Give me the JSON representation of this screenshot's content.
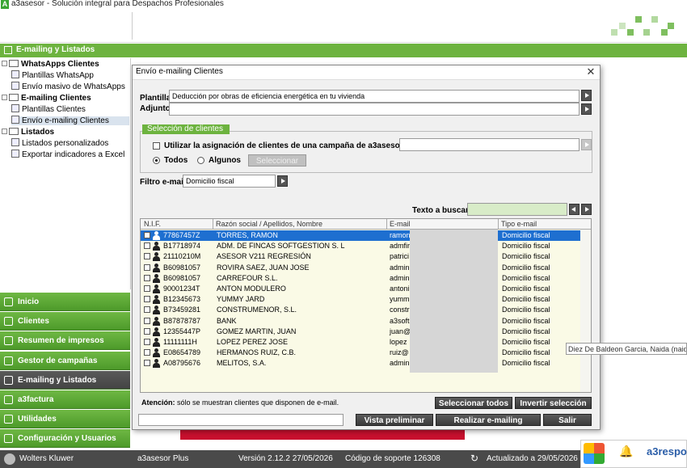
{
  "window": {
    "title": "a3asesor - Solución integral para Despachos Profesionales",
    "logo_letter": "A"
  },
  "section_bar": {
    "label": "E-mailing y Listados"
  },
  "tree": [
    {
      "label": "WhatsApps Clientes",
      "level": 0,
      "bold": true
    },
    {
      "label": "Plantillas WhatsApp",
      "level": 1
    },
    {
      "label": "Envío masivo de WhatsApps",
      "level": 1
    },
    {
      "label": "E-mailing Clientes",
      "level": 0,
      "bold": true
    },
    {
      "label": "Plantillas Clientes",
      "level": 1
    },
    {
      "label": "Envío e-mailing Clientes",
      "level": 1,
      "selected": true
    },
    {
      "label": "Listados",
      "level": 0,
      "bold": true
    },
    {
      "label": "Listados personalizados",
      "level": 1
    },
    {
      "label": "Exportar indicadores a Excel",
      "level": 1
    }
  ],
  "nav": [
    {
      "label": "Inicio",
      "icon": "home-icon"
    },
    {
      "label": "Clientes",
      "icon": "user-icon"
    },
    {
      "label": "Resumen de impresos",
      "icon": "document-icon"
    },
    {
      "label": "Gestor de campañas",
      "icon": "calendar-icon"
    },
    {
      "label": "E-mailing y Listados",
      "icon": "mail-icon",
      "active": true
    },
    {
      "label": "a3factura",
      "icon": "invoice-icon"
    },
    {
      "label": "Utilidades",
      "icon": "tools-icon"
    },
    {
      "label": "Configuración y Usuarios",
      "icon": "settings-icon"
    }
  ],
  "dialog": {
    "title": "Envío e-mailing Clientes",
    "close": "✕",
    "plantilla_label": "Plantilla",
    "plantilla_value": "Deducción por obras de eficiencia energética en tu vivienda",
    "adjunto_label": "Adjunto",
    "adjunto_value": "",
    "seleccion_title": "Selección de clientes",
    "campaign_check_label": "Utilizar la asignación de clientes de una campaña de a3asesor",
    "campaign_value": "",
    "radio_todos": "Todos",
    "radio_algunos": "Algunos",
    "seleccionar_button": "Seleccionar",
    "filtro_label": "Filtro e-mail",
    "filtro_value": "Domicilio fiscal",
    "buscar_label": "Texto a buscar",
    "buscar_value": "",
    "columns": [
      "N.I.F.",
      "Razón social / Apellidos, Nombre",
      "E-mail",
      "Tipo e-mail"
    ],
    "rows": [
      {
        "nif": "77867457Z",
        "name": "TORRES, RAMON",
        "email": "ramon",
        "tipo": "Domicilio fiscal",
        "selected": true
      },
      {
        "nif": "B17718974",
        "name": "ADM. DE FINCAS SOFTGESTION S. L",
        "email": "admfir",
        "tipo": "Domicilio fiscal"
      },
      {
        "nif": "21110210M",
        "name": "ASESOR V211 REGRESIÓN",
        "email": "patrici",
        "tipo": "Domicilio fiscal"
      },
      {
        "nif": "B60981057",
        "name": "ROVIRA SAEZ, JUAN JOSE",
        "email": "admin",
        "tipo": "Domicilio fiscal"
      },
      {
        "nif": "B60981057",
        "name": "CARREFOUR S.L.",
        "email": "admin",
        "tipo": "Domicilio fiscal"
      },
      {
        "nif": "90001234T",
        "name": "ANTON MODULERO",
        "email": "antoni",
        "tipo": "Domicilio fiscal"
      },
      {
        "nif": "B12345673",
        "name": "YUMMY JARD",
        "email": "yumm",
        "tipo": "Domicilio fiscal"
      },
      {
        "nif": "B73459281",
        "name": "CONSTRUMENOR, S.L.",
        "email": "constr",
        "tipo": "Domicilio fiscal"
      },
      {
        "nif": "B87878787",
        "name": "BANK",
        "email": "a3soft",
        "tipo": "Domicilio fiscal"
      },
      {
        "nif": "12355447P",
        "name": "GOMEZ  MARTIN, JUAN",
        "email": "juan@",
        "tipo": "Domicilio fiscal"
      },
      {
        "nif": "11111111H",
        "name": "LOPEZ PEREZ JOSE",
        "email": "lopez",
        "tipo": "Domicilio fiscal"
      },
      {
        "nif": "E08654789",
        "name": "HERMANOS RUIZ, C.B.",
        "email": "ruiz@",
        "tipo": "Domicilio fiscal"
      },
      {
        "nif": "A08795676",
        "name": "MELITOS, S.A.",
        "email": "admin",
        "tipo": "Domicilio fiscal"
      }
    ],
    "attention_bold": "Atención:",
    "attention_text": " sólo se muestran clientes que disponen de e-mail.",
    "select_all_button": "Seleccionar todos",
    "invert_button": "Invertir selección",
    "preview_button": "Vista preliminar",
    "send_button": "Realizar e-mailing",
    "exit_button": "Salir"
  },
  "tooltip": "Diez De Baldeon Garcia, Naida (naida.diez",
  "status": {
    "company": "Wolters Kluwer",
    "product": "a3asesor Plus",
    "version": "Versión  2.12.2  27/05/2026",
    "support": "Código de soporte  126308",
    "updated": "Actualizado a 29/05/2026"
  },
  "notification": {
    "text": "a3respo"
  },
  "colors": {
    "brand_green": "#6db33f",
    "selection_blue": "#1e6fd0",
    "status_bar": "#4a4a4a"
  }
}
